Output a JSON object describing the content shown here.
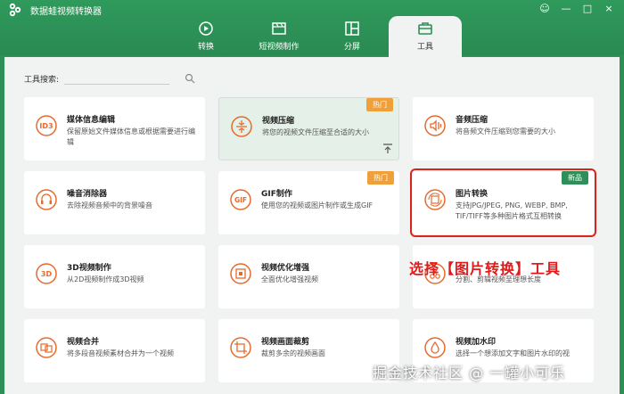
{
  "app": {
    "title": "数据蛙视频转换器",
    "window_controls": [
      "☺",
      "—",
      "□",
      "×"
    ]
  },
  "tabs": [
    {
      "label": "转换",
      "icon": "convert-icon",
      "active": false
    },
    {
      "label": "短视频制作",
      "icon": "short-video-icon",
      "active": false
    },
    {
      "label": "分屏",
      "icon": "split-screen-icon",
      "active": false
    },
    {
      "label": "工具",
      "icon": "toolbox-icon",
      "active": true
    }
  ],
  "search": {
    "label": "工具搜索:",
    "placeholder": ""
  },
  "tools": [
    {
      "title": "媒体信息编辑",
      "desc": "保留原始文件媒体信息或根据需要进行编辑",
      "icon": "id3-icon",
      "icon_text": "ID3"
    },
    {
      "title": "视频压缩",
      "desc": "将您的视频文件压缩至合适的大小",
      "icon": "compress-icon",
      "badge": "热门",
      "highlight": true
    },
    {
      "title": "音频压缩",
      "desc": "将音频文件压缩到您需要的大小",
      "icon": "audio-compress-icon"
    },
    {
      "title": "噪音消除器",
      "desc": "去除视频音频中的背景噪音",
      "icon": "noise-icon"
    },
    {
      "title": "GIF制作",
      "desc": "使用您的视频或图片制作或生成GIF",
      "icon": "gif-icon",
      "icon_text": "GIF",
      "badge": "热门"
    },
    {
      "title": "图片转换",
      "desc": "支持JPG/JPEG, PNG, WEBP, BMP, TIF/TIFF等多种图片格式互相转换",
      "icon": "image-convert-icon",
      "badge": "新品",
      "badge_type": "new",
      "selected": true
    },
    {
      "title": "3D视频制作",
      "desc": "从2D视频制作成3D视频",
      "icon": "3d-icon",
      "icon_text": "3D"
    },
    {
      "title": "视频优化增强",
      "desc": "全面优化增强视频",
      "icon": "enhance-icon"
    },
    {
      "title": "",
      "desc": "分割、剪辑视频至理想长度",
      "icon": "trim-icon"
    },
    {
      "title": "视频合并",
      "desc": "将多段音视频素材合并为一个视频",
      "icon": "merge-icon"
    },
    {
      "title": "视频画面裁剪",
      "desc": "裁剪多余的视频画面",
      "icon": "crop-icon"
    },
    {
      "title": "视频加水印",
      "desc": "选择一个想添加文字和图片水印的视",
      "icon": "watermark-icon"
    }
  ],
  "annotation": "选择【图片转换】工具",
  "watermark": "掘金技术社区 @ 一罐小可乐",
  "colors": {
    "brand": "#2d8f56",
    "hot": "#f0a039",
    "new": "#2f8f58",
    "annotation": "#e01a1a",
    "icon": "#e66a2c"
  }
}
